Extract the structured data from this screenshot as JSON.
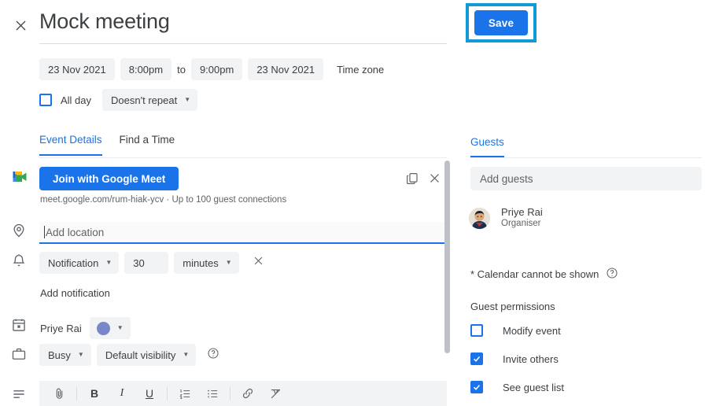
{
  "header": {
    "close_icon": "close-icon",
    "title": "Mock meeting",
    "title_placeholder": "Add title",
    "save_label": "Save"
  },
  "colors": {
    "accent_blue": "#1a73e8",
    "highlight_annotation": "#129ad6",
    "calendar_swatch": "#7986cb",
    "chip_bg": "#f1f3f4",
    "text": "#3c4043",
    "muted_text": "#5f6368"
  },
  "schedule": {
    "start_date": "23 Nov 2021",
    "start_time": "8:00pm",
    "to_label": "to",
    "end_time": "9:00pm",
    "end_date": "23 Nov 2021",
    "time_zone_label": "Time zone",
    "all_day_label": "All day",
    "all_day_checked": false,
    "repeat_value": "Doesn't repeat"
  },
  "tabs": {
    "items": [
      {
        "label": "Event Details",
        "active": true
      },
      {
        "label": "Find a Time",
        "active": false
      }
    ]
  },
  "conference": {
    "icon": "google-meet-icon",
    "join_label": "Join with Google Meet",
    "details": "meet.google.com/rum-hiak-ycv · Up to 100 guest connections",
    "copy_icon": "copy-link-icon",
    "remove_icon": "close-icon"
  },
  "location": {
    "icon": "location-pin-icon",
    "value": "",
    "placeholder": "Add location",
    "focused": true
  },
  "notification": {
    "icon": "bell-icon",
    "type": "Notification",
    "amount": "30",
    "unit": "minutes",
    "remove_icon": "close-icon",
    "add_label": "Add notification"
  },
  "calendar_owner": {
    "icon": "calendar-icon",
    "name": "Priye Rai",
    "color": "#7986cb"
  },
  "availability": {
    "icon": "briefcase-icon",
    "busy_value": "Busy",
    "visibility_value": "Default visibility",
    "help_icon": "help-circle-icon"
  },
  "description": {
    "icon": "description-lines-icon",
    "toolbar": [
      {
        "name": "attach-icon",
        "label": ""
      },
      {
        "name": "bold-icon",
        "label": "B"
      },
      {
        "name": "italic-icon",
        "label": "I"
      },
      {
        "name": "underline-icon",
        "label": "U"
      },
      {
        "name": "numbered-list-icon",
        "label": ""
      },
      {
        "name": "bulleted-list-icon",
        "label": ""
      },
      {
        "name": "link-icon",
        "label": ""
      },
      {
        "name": "clear-formatting-icon",
        "label": ""
      }
    ]
  },
  "guests_panel": {
    "tab_label": "Guests",
    "add_guests_placeholder": "Add guests",
    "add_guests_value": "",
    "guest": {
      "name": "Priye Rai",
      "role": "Organiser",
      "avatar": "user-avatar"
    },
    "calendar_note": "* Calendar cannot be shown",
    "calendar_note_help_icon": "help-circle-icon",
    "permissions_title": "Guest permissions",
    "permissions": [
      {
        "label": "Modify event",
        "checked": false
      },
      {
        "label": "Invite others",
        "checked": true
      },
      {
        "label": "See guest list",
        "checked": true
      }
    ]
  }
}
